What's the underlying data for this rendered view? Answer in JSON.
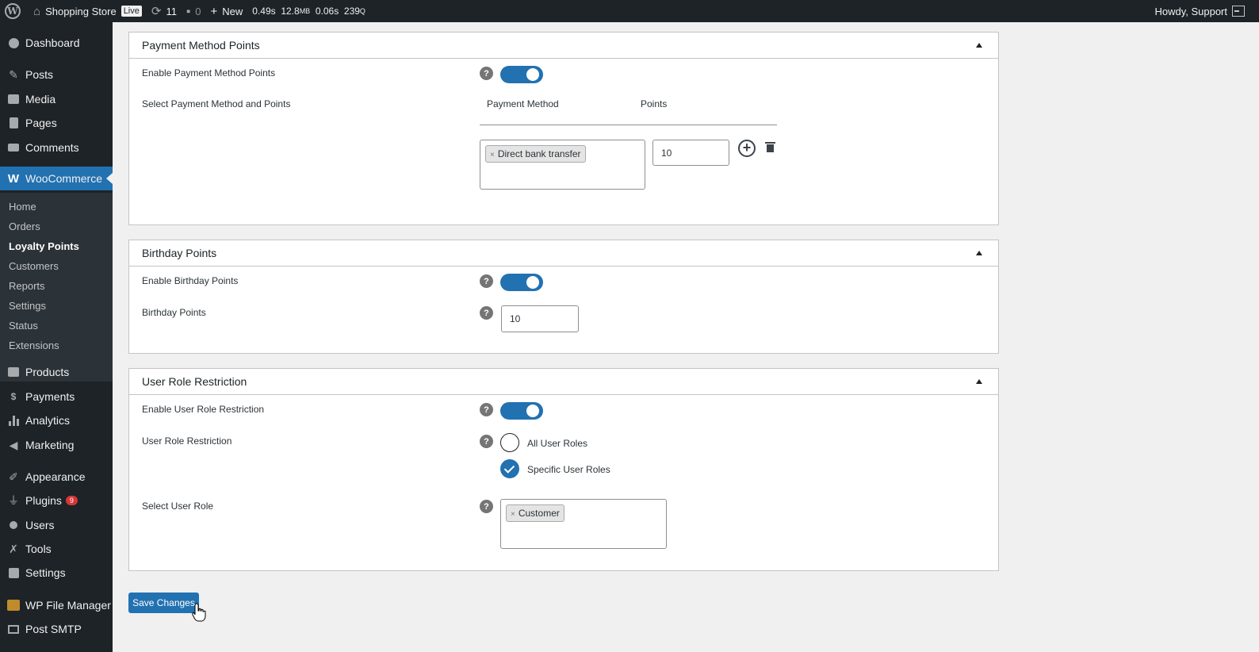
{
  "adminbar": {
    "site_name": "Shopping Store",
    "live_badge": "Live",
    "updates_count": "11",
    "comments_count": "0",
    "new_label": "New",
    "perf_time": "0.49s",
    "perf_mem": "12.8",
    "perf_mem_unit": "MB",
    "perf_db_time": "0.06s",
    "perf_queries": "239",
    "perf_queries_unit": "Q",
    "howdy": "Howdy, Support"
  },
  "sidebar": {
    "dashboard": "Dashboard",
    "posts": "Posts",
    "media": "Media",
    "pages": "Pages",
    "comments": "Comments",
    "woocommerce": "WooCommerce",
    "sub": {
      "home": "Home",
      "orders": "Orders",
      "loyalty": "Loyalty Points",
      "customers": "Customers",
      "reports": "Reports",
      "settings": "Settings",
      "status": "Status",
      "extensions": "Extensions"
    },
    "products": "Products",
    "payments": "Payments",
    "analytics": "Analytics",
    "marketing": "Marketing",
    "appearance": "Appearance",
    "plugins": "Plugins",
    "plugins_badge": "9",
    "users": "Users",
    "tools": "Tools",
    "settings": "Settings",
    "file_manager": "WP File Manager",
    "post_smtp": "Post SMTP"
  },
  "payment_panel": {
    "title": "Payment Method Points",
    "enable_label": "Enable Payment Method Points",
    "enabled": true,
    "select_label": "Select Payment Method and Points",
    "col_method": "Payment Method",
    "col_points": "Points",
    "method_chip": "Direct bank transfer",
    "points_value": "10"
  },
  "birthday_panel": {
    "title": "Birthday Points",
    "enable_label": "Enable Birthday Points",
    "enabled": true,
    "points_label": "Birthday Points",
    "points_value": "10"
  },
  "role_panel": {
    "title": "User Role Restriction",
    "enable_label": "Enable User Role Restriction",
    "enabled": true,
    "restriction_label": "User Role Restriction",
    "option_all": "All User Roles",
    "option_specific": "Specific User Roles",
    "selected_option": "Specific User Roles",
    "select_label": "Select User Role",
    "role_chip": "Customer"
  },
  "save_label": "Save Changes",
  "help_glyph": "?",
  "chip_remove_glyph": "×",
  "colors": {
    "primary": "#2271b1",
    "adminbar_bg": "#1d2327",
    "badge_red": "#d63638"
  }
}
